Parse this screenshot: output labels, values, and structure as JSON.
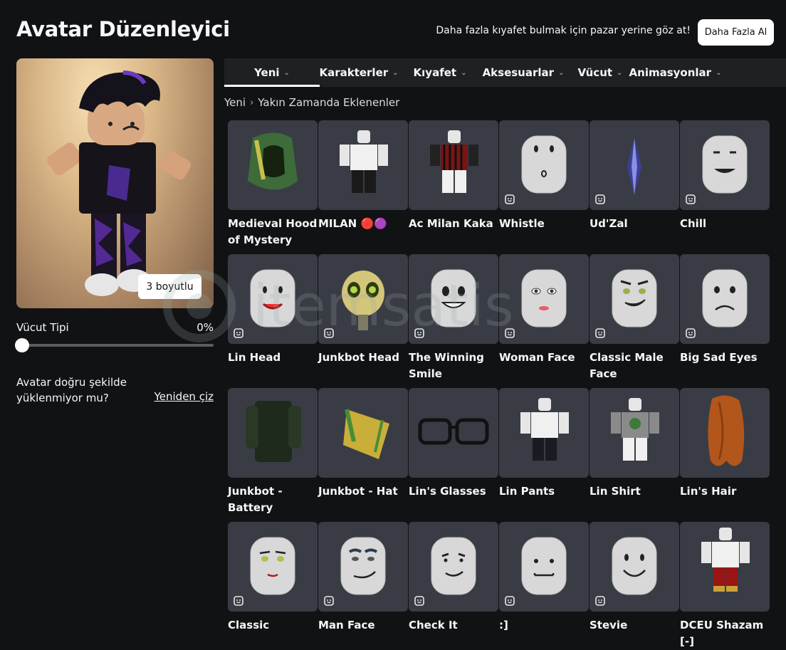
{
  "header": {
    "title": "Avatar Düzenleyici",
    "promo_text": "Daha fazla kıyafet bulmak için pazar yerine göz at!",
    "promo_button": "Daha Fazla Al"
  },
  "preview": {
    "view_3d_button": "3 boyutlu"
  },
  "body_type": {
    "label": "Vücut Tipi",
    "value_text": "0%",
    "value": 0
  },
  "redraw": {
    "question": "Avatar doğru şekilde yüklenmiyor mu?",
    "link": "Yeniden çiz"
  },
  "tabs": [
    {
      "label": "Yeni",
      "active": true
    },
    {
      "label": "Karakterler",
      "active": false
    },
    {
      "label": "Kıyafet",
      "active": false
    },
    {
      "label": "Aksesuarlar",
      "active": false
    },
    {
      "label": "Vücut",
      "active": false
    },
    {
      "label": "Animasyonlar",
      "active": false
    }
  ],
  "breadcrumb": {
    "root": "Yeni",
    "current": "Yakın Zamanda Eklenenler"
  },
  "items": [
    {
      "name": "Medieval Hood of Mystery",
      "icon": "hood",
      "dynamic": false
    },
    {
      "name": "MILAN 🔴🟣",
      "icon": "outfit-white",
      "dynamic": false
    },
    {
      "name": "Ac Milan Kaka",
      "icon": "outfit-milan",
      "dynamic": false
    },
    {
      "name": "Whistle",
      "icon": "face-whistle",
      "dynamic": true
    },
    {
      "name": "Ud'Zal",
      "icon": "ud-zal-crystal",
      "dynamic": true
    },
    {
      "name": "Chill",
      "icon": "face-chill",
      "dynamic": true
    },
    {
      "name": "Lin Head",
      "icon": "face-lin",
      "dynamic": true
    },
    {
      "name": "Junkbot Head",
      "icon": "junkbot-head",
      "dynamic": true
    },
    {
      "name": "The Winning Smile",
      "icon": "face-winning",
      "dynamic": true
    },
    {
      "name": "Woman Face",
      "icon": "face-woman",
      "dynamic": true
    },
    {
      "name": "Classic Male Face",
      "icon": "face-classic-male",
      "dynamic": true
    },
    {
      "name": "Big Sad Eyes",
      "icon": "face-sad",
      "dynamic": true
    },
    {
      "name": "Junkbot - Battery",
      "icon": "junkbot-battery",
      "dynamic": false
    },
    {
      "name": "Junkbot - Hat",
      "icon": "junkbot-hat",
      "dynamic": false
    },
    {
      "name": "Lin's Glasses",
      "icon": "glasses",
      "dynamic": false
    },
    {
      "name": "Lin Pants",
      "icon": "outfit-pants",
      "dynamic": false
    },
    {
      "name": "Lin Shirt",
      "icon": "outfit-shirt",
      "dynamic": false
    },
    {
      "name": "Lin's Hair",
      "icon": "hair",
      "dynamic": false
    },
    {
      "name": "Classic",
      "icon": "face-classic-female",
      "dynamic": true
    },
    {
      "name": "Man Face",
      "icon": "face-man",
      "dynamic": true
    },
    {
      "name": "Check It",
      "icon": "face-check-it",
      "dynamic": true
    },
    {
      "name": ":]",
      "icon": "face-bracket",
      "dynamic": true
    },
    {
      "name": "Stevie",
      "icon": "face-stevie",
      "dynamic": true
    },
    {
      "name": "DCEU Shazam [-]",
      "icon": "outfit-shazam",
      "dynamic": false
    }
  ],
  "watermark": "itemsatis"
}
